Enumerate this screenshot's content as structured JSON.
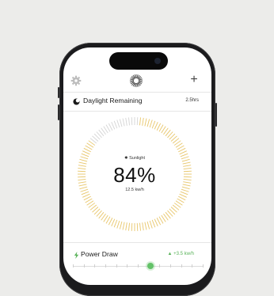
{
  "header": {
    "settings_icon": "gear-icon",
    "logo_icon": "sun-icon",
    "add_label": "+"
  },
  "daylight": {
    "title": "Daylight Remaining",
    "value": "2.5hrs",
    "icon": "moon-icon"
  },
  "gauge": {
    "source_label": "Sunlight",
    "percent_label": "84%",
    "rate_label": "12.5 kw/h",
    "level": 0.84,
    "active_color": "#e8c66a",
    "inactive_color": "#d4d4d4"
  },
  "power": {
    "title": "Power Draw",
    "delta": "+3.5 kw/h",
    "icon": "bolt-icon",
    "delta_icon": "triangle-up-icon",
    "accent": "#5bb35b",
    "slider_level": 0.5
  }
}
